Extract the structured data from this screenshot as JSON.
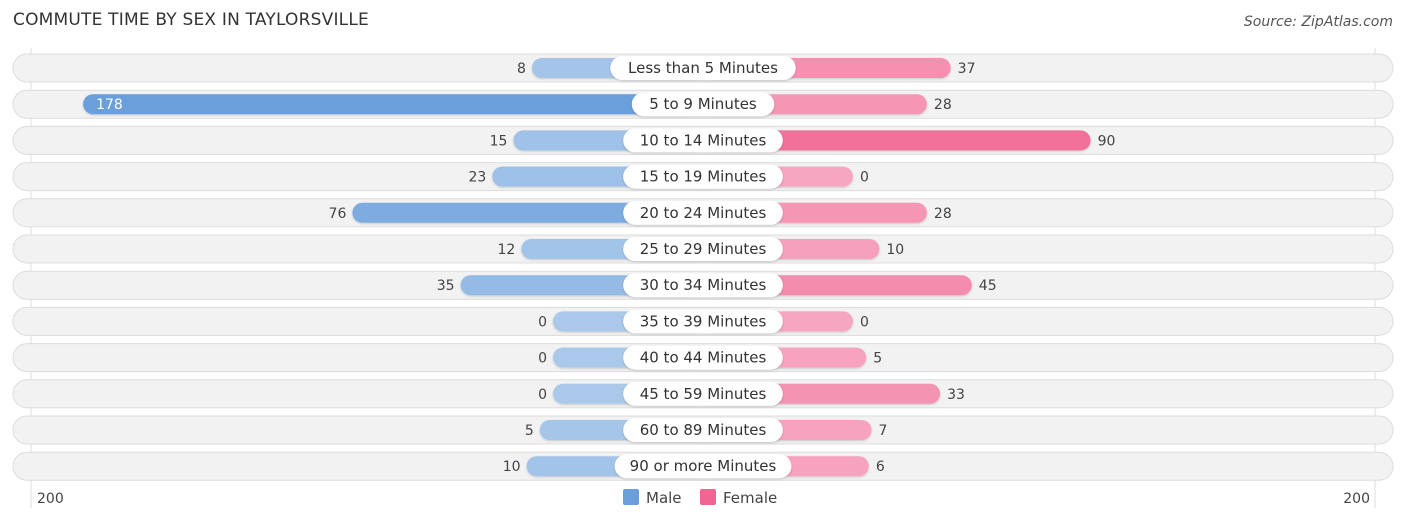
{
  "header": {
    "title": "COMMUTE TIME BY SEX IN TAYLORSVILLE",
    "source": "Source: ZipAtlas.com"
  },
  "chart_data": {
    "type": "bar",
    "orientation": "horizontal-diverging",
    "title": "COMMUTE TIME BY SEX IN TAYLORSVILLE",
    "categories": [
      "Less than 5 Minutes",
      "5 to 9 Minutes",
      "10 to 14 Minutes",
      "15 to 19 Minutes",
      "20 to 24 Minutes",
      "25 to 29 Minutes",
      "30 to 34 Minutes",
      "35 to 39 Minutes",
      "40 to 44 Minutes",
      "45 to 59 Minutes",
      "60 to 89 Minutes",
      "90 or more Minutes"
    ],
    "series": [
      {
        "name": "Male",
        "color": "#6a9fdb",
        "light_color": "#a9c8ea",
        "values": [
          8,
          178,
          15,
          23,
          76,
          12,
          35,
          0,
          0,
          0,
          5,
          10
        ]
      },
      {
        "name": "Female",
        "color": "#f06592",
        "light_color": "#f7a6c1",
        "values": [
          37,
          28,
          90,
          0,
          28,
          10,
          45,
          0,
          5,
          33,
          7,
          6
        ]
      }
    ],
    "axis": {
      "left_label": "200",
      "right_label": "200",
      "max": 200
    },
    "legend": {
      "position": "bottom-center",
      "items": [
        "Male",
        "Female"
      ]
    }
  }
}
